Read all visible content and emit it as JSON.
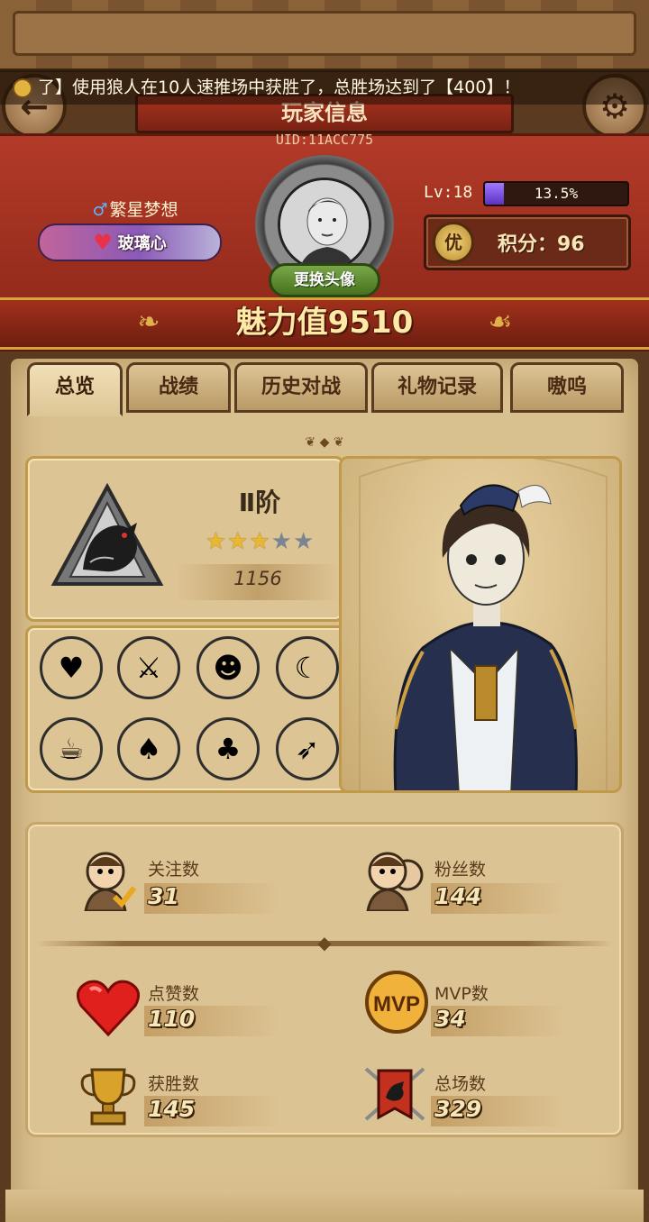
{
  "ticker": {
    "text": "了】使用狼人在10人速推场中获胜了，总胜场达到了【400】！"
  },
  "header": {
    "title": "玩家信息",
    "uid": "UID:11ACC775"
  },
  "profile": {
    "gender_symbol": "♂",
    "nickname": "繁星梦想",
    "title_badge": "玻璃心",
    "change_avatar_label": "更换头像",
    "level_label": "Lv:18",
    "exp_text": "13.5%",
    "exp_fraction": 0.135,
    "score_icon_label": "优",
    "score_text": "积分：96"
  },
  "charm": {
    "label": "魅力值",
    "value": "9510"
  },
  "tabs": [
    {
      "label": "总览",
      "active": true
    },
    {
      "label": "战绩",
      "active": false
    },
    {
      "label": "历史对战",
      "active": false
    },
    {
      "label": "礼物记录",
      "active": false
    },
    {
      "label": "嗷呜",
      "active": false
    }
  ],
  "rank": {
    "tier": "Ⅱ阶",
    "stars_filled": 3,
    "stars_total": 5,
    "points": "1156"
  },
  "badges": [
    {
      "icon": "broken-heart-icon",
      "style": "pink"
    },
    {
      "icon": "green-cannon-icon",
      "style": "green"
    },
    {
      "icon": "werewolf-head-icon",
      "style": "gray"
    },
    {
      "icon": "wolf-howl-icon",
      "style": "gray"
    },
    {
      "icon": "potion-cup-icon",
      "style": "gray"
    },
    {
      "icon": "card-deck-icon",
      "style": "gray"
    },
    {
      "icon": "cards-hand-icon",
      "style": "gray"
    },
    {
      "icon": "crossbow-icon",
      "style": "gray"
    }
  ],
  "stats": {
    "following": {
      "label": "关注数",
      "value": "31",
      "icon": "follow-person-icon"
    },
    "fans": {
      "label": "粉丝数",
      "value": "144",
      "icon": "fans-people-icon"
    },
    "likes": {
      "label": "点赞数",
      "value": "110",
      "icon": "heart-icon"
    },
    "mvp": {
      "label": "MVP数",
      "value": "34",
      "icon": "mvp-medal-icon",
      "icon_text": "MVP"
    },
    "wins": {
      "label": "获胜数",
      "value": "145",
      "icon": "trophy-icon"
    },
    "total": {
      "label": "总场数",
      "value": "329",
      "icon": "battle-banner-icon"
    }
  },
  "colors": {
    "accent_red": "#a6321e",
    "parchment": "#d9c08f",
    "exp_purple": "#7a52e0"
  }
}
